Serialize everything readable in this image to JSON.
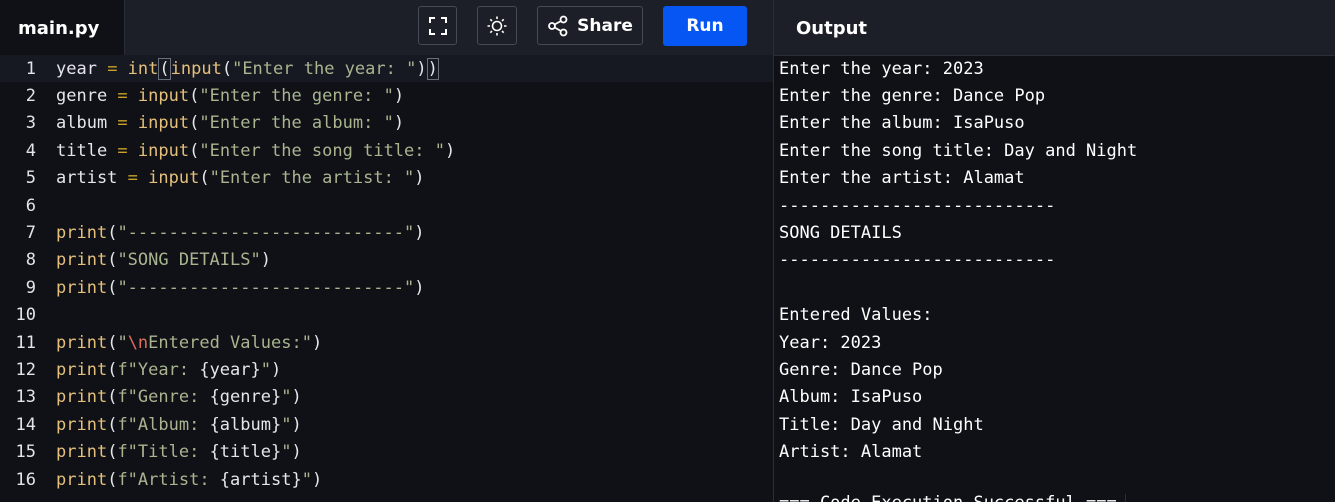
{
  "header": {
    "file_tab": "main.py",
    "share_label": "Share",
    "run_label": "Run",
    "output_title": "Output"
  },
  "editor": {
    "lines": [
      {
        "num": "1",
        "tokens": [
          [
            "var",
            "year"
          ],
          [
            "op",
            " = "
          ],
          [
            "fn",
            "int"
          ],
          [
            "bracket",
            "("
          ],
          [
            "fn",
            "input"
          ],
          [
            "plain",
            "("
          ],
          [
            "str",
            "\"Enter the year: \""
          ],
          [
            "plain",
            ")"
          ],
          [
            "bracket",
            ")"
          ]
        ]
      },
      {
        "num": "2",
        "tokens": [
          [
            "var",
            "genre"
          ],
          [
            "op",
            " = "
          ],
          [
            "fn",
            "input"
          ],
          [
            "plain",
            "("
          ],
          [
            "str",
            "\"Enter the genre: \""
          ],
          [
            "plain",
            ")"
          ]
        ]
      },
      {
        "num": "3",
        "tokens": [
          [
            "var",
            "album"
          ],
          [
            "op",
            " = "
          ],
          [
            "fn",
            "input"
          ],
          [
            "plain",
            "("
          ],
          [
            "str",
            "\"Enter the album: \""
          ],
          [
            "plain",
            ")"
          ]
        ]
      },
      {
        "num": "4",
        "tokens": [
          [
            "var",
            "title"
          ],
          [
            "op",
            " = "
          ],
          [
            "fn",
            "input"
          ],
          [
            "plain",
            "("
          ],
          [
            "str",
            "\"Enter the song title: \""
          ],
          [
            "plain",
            ")"
          ]
        ]
      },
      {
        "num": "5",
        "tokens": [
          [
            "var",
            "artist"
          ],
          [
            "op",
            " = "
          ],
          [
            "fn",
            "input"
          ],
          [
            "plain",
            "("
          ],
          [
            "str",
            "\"Enter the artist: \""
          ],
          [
            "plain",
            ")"
          ]
        ]
      },
      {
        "num": "6",
        "tokens": []
      },
      {
        "num": "7",
        "tokens": [
          [
            "fn",
            "print"
          ],
          [
            "plain",
            "("
          ],
          [
            "str",
            "\"---------------------------\""
          ],
          [
            "plain",
            ")"
          ]
        ]
      },
      {
        "num": "8",
        "tokens": [
          [
            "fn",
            "print"
          ],
          [
            "plain",
            "("
          ],
          [
            "str",
            "\"SONG DETAILS\""
          ],
          [
            "plain",
            ")"
          ]
        ]
      },
      {
        "num": "9",
        "tokens": [
          [
            "fn",
            "print"
          ],
          [
            "plain",
            "("
          ],
          [
            "str",
            "\"---------------------------\""
          ],
          [
            "plain",
            ")"
          ]
        ]
      },
      {
        "num": "10",
        "tokens": []
      },
      {
        "num": "11",
        "tokens": [
          [
            "fn",
            "print"
          ],
          [
            "plain",
            "("
          ],
          [
            "str",
            "\""
          ],
          [
            "esc",
            "\\n"
          ],
          [
            "str",
            "Entered Values:\""
          ],
          [
            "plain",
            ")"
          ]
        ]
      },
      {
        "num": "12",
        "tokens": [
          [
            "fn",
            "print"
          ],
          [
            "plain",
            "("
          ],
          [
            "str",
            "f\"Year: "
          ],
          [
            "var",
            "{year}"
          ],
          [
            "str",
            "\""
          ],
          [
            "plain",
            ")"
          ]
        ]
      },
      {
        "num": "13",
        "tokens": [
          [
            "fn",
            "print"
          ],
          [
            "plain",
            "("
          ],
          [
            "str",
            "f\"Genre: "
          ],
          [
            "var",
            "{genre}"
          ],
          [
            "str",
            "\""
          ],
          [
            "plain",
            ")"
          ]
        ]
      },
      {
        "num": "14",
        "tokens": [
          [
            "fn",
            "print"
          ],
          [
            "plain",
            "("
          ],
          [
            "str",
            "f\"Album: "
          ],
          [
            "var",
            "{album}"
          ],
          [
            "str",
            "\""
          ],
          [
            "plain",
            ")"
          ]
        ]
      },
      {
        "num": "15",
        "tokens": [
          [
            "fn",
            "print"
          ],
          [
            "plain",
            "("
          ],
          [
            "str",
            "f\"Title: "
          ],
          [
            "var",
            "{title}"
          ],
          [
            "str",
            "\""
          ],
          [
            "plain",
            ")"
          ]
        ]
      },
      {
        "num": "16",
        "tokens": [
          [
            "fn",
            "print"
          ],
          [
            "plain",
            "("
          ],
          [
            "str",
            "f\"Artist: "
          ],
          [
            "var",
            "{artist}"
          ],
          [
            "str",
            "\""
          ],
          [
            "plain",
            ")"
          ]
        ]
      }
    ]
  },
  "output": {
    "lines": [
      "Enter the year: 2023",
      "Enter the genre: Dance Pop",
      "Enter the album: IsaPuso",
      "Enter the song title: Day and Night",
      "Enter the artist: Alamat",
      "---------------------------",
      "SONG DETAILS",
      "---------------------------",
      "",
      "Entered Values:",
      "Year: 2023",
      "Genre: Dance Pop",
      "Album: IsaPuso",
      "Title: Day and Night",
      "Artist: Alamat",
      ""
    ],
    "status_line": "=== Code Execution Successful ==="
  },
  "colors": {
    "run_button": "#0556f3",
    "function": "#e5c07b",
    "string": "#a8b58f",
    "escape": "#e06c5a"
  },
  "icons": {
    "fullscreen": "fullscreen-icon",
    "theme": "sun-icon",
    "share": "share-icon"
  }
}
